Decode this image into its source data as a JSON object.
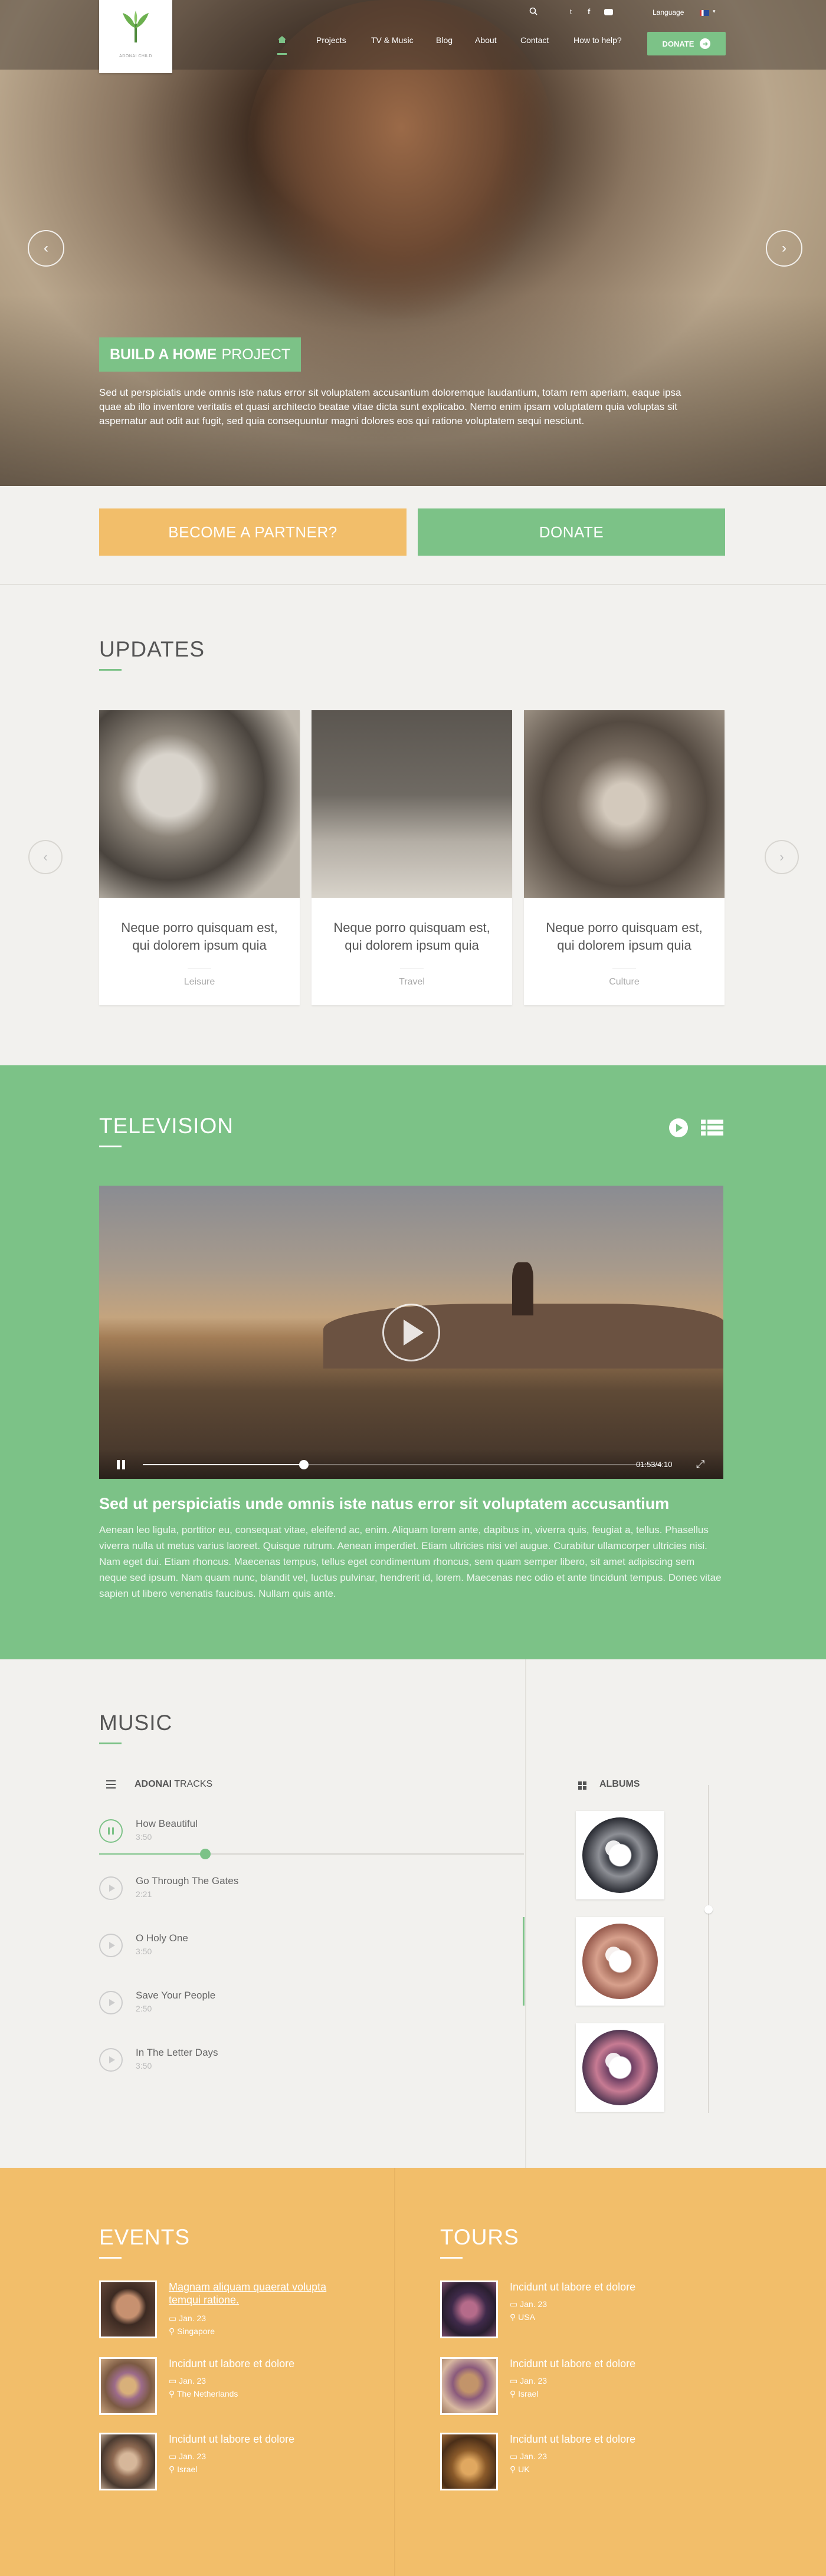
{
  "header": {
    "language_label": "Language",
    "nav": [
      "Projects",
      "TV & Music",
      "Blog",
      "About",
      "Contact",
      "How to help?"
    ],
    "donate_label": "DONATE",
    "logo_text": "ADONAI CHILD"
  },
  "hero": {
    "badge_bold": "BUILD A HOME",
    "badge_light": "PROJECT",
    "text": "Sed ut perspiciatis unde omnis iste natus error sit voluptatem accusantium doloremque laudantium, totam rem aperiam, eaque ipsa quae ab illo inventore veritatis et quasi architecto beatae vitae dicta sunt explicabo. Nemo enim ipsam voluptatem quia voluptas sit aspernatur aut odit aut fugit, sed quia consequuntur magni dolores eos qui ratione voluptatem sequi nesciunt."
  },
  "cta": {
    "partner_label": "BECOME A PARTNER?",
    "donate_label": "DONATE"
  },
  "updates": {
    "title": "UPDATES",
    "cards": [
      {
        "caption_l1": "Neque porro quisquam est,",
        "caption_l2": "qui dolorem ipsum quia",
        "tag": "Leisure"
      },
      {
        "caption_l1": "Neque porro quisquam est,",
        "caption_l2": "qui dolorem ipsum quia",
        "tag": "Travel"
      },
      {
        "caption_l1": "Neque porro quisquam est,",
        "caption_l2": "qui dolorem ipsum quia",
        "tag": "Culture"
      }
    ]
  },
  "television": {
    "title": "TELEVISION",
    "time": "01:53/4:10",
    "progress": 0.31,
    "video_title": "Sed ut perspiciatis unde omnis iste natus error sit voluptatem accusantium",
    "text": "Aenean leo ligula, porttitor eu, consequat vitae, eleifend ac, enim. Aliquam lorem ante, dapibus in, viverra quis, feugiat a, tellus. Phasellus viverra nulla ut metus varius laoreet. Quisque rutrum. Aenean imperdiet. Etiam ultricies nisi vel augue. Curabitur ullamcorper ultricies nisi. Nam eget dui. Etiam rhoncus. Maecenas tempus, tellus eget condimentum rhoncus, sem quam semper libero, sit amet adipiscing sem neque sed ipsum. Nam quam nunc, blandit vel, luctus pulvinar, hendrerit id, lorem. Maecenas nec odio et ante tincidunt tempus. Donec vitae sapien ut libero venenatis faucibus. Nullam quis ante."
  },
  "music": {
    "title": "MUSIC",
    "tracks_bold": "ADONAI",
    "tracks_light": "TRACKS",
    "albums_label": "ALBUMS",
    "progress": 0.25,
    "tracks": [
      {
        "name": "How Beautiful",
        "duration": "3:50"
      },
      {
        "name": "Go Through The Gates",
        "duration": "2:21"
      },
      {
        "name": "O Holy One",
        "duration": "3:50"
      },
      {
        "name": "Save Your People",
        "duration": "2:50"
      },
      {
        "name": "In The Letter Days",
        "duration": "3:50"
      }
    ]
  },
  "events": {
    "title": "EVENTS",
    "items": [
      {
        "name": "Magnam aliquam quaerat volupta temqui ratione.",
        "date": "Jan. 23",
        "place": "Singapore"
      },
      {
        "name": "Incidunt ut labore et dolore",
        "date": "Jan. 23",
        "place": "The Netherlands"
      },
      {
        "name": "Incidunt ut labore et dolore",
        "date": "Jan. 23",
        "place": "Israel"
      }
    ]
  },
  "tours": {
    "title": "TOURS",
    "items": [
      {
        "name": "Incidunt ut labore et dolore",
        "date": "Jan. 23",
        "place": "USA"
      },
      {
        "name": "Incidunt ut labore et dolore",
        "date": "Jan. 23",
        "place": "Israel"
      },
      {
        "name": "Incidunt ut labore et dolore",
        "date": "Jan. 23",
        "place": "UK"
      }
    ]
  },
  "colors": {
    "accent_green": "#7cc287",
    "accent_orange": "#f2be6a",
    "background": "#f2f1ee"
  },
  "icons": [
    "search-icon",
    "twitter-icon",
    "facebook-icon",
    "youtube-icon",
    "flag-icon",
    "arrow-left-icon",
    "arrow-right-icon",
    "play-icon",
    "pause-icon",
    "fullscreen-icon",
    "list-icon",
    "menu-icon",
    "grid-icon",
    "calendar-icon",
    "pin-icon"
  ]
}
